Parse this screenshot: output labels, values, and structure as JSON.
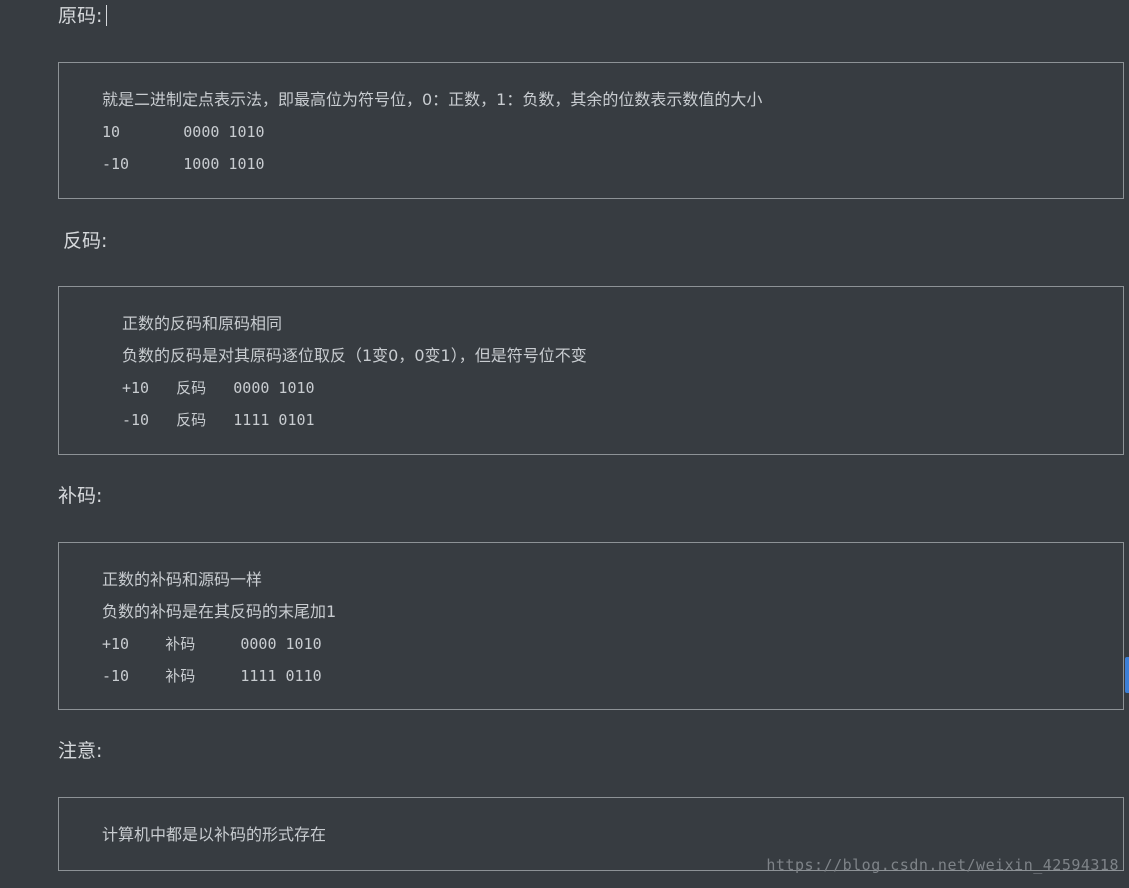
{
  "sections": [
    {
      "heading": "原码:",
      "lines": [
        "就是二进制定点表示法，即最高位为符号位，0：正数，1：负数，其余的位数表示数值的大小",
        "10       0000 1010",
        "-10      1000 1010"
      ]
    },
    {
      "heading": "反码:",
      "lines": [
        "正数的反码和原码相同",
        "负数的反码是对其原码逐位取反（1变0，0变1），但是符号位不变",
        "+10   反码   0000 1010",
        "-10   反码   1111 0101"
      ]
    },
    {
      "heading": "补码:",
      "lines": [
        "正数的补码和源码一样",
        "负数的补码是在其反码的末尾加1",
        "+10    补码     0000 1010",
        "-10    补码     1111 0110"
      ]
    },
    {
      "heading": "注意:",
      "lines": [
        "计算机中都是以补码的形式存在"
      ]
    }
  ],
  "watermark": "https://blog.csdn.net/weixin_42594318",
  "colors": {
    "background": "#373c41",
    "text": "#c8ccd0",
    "box_border": "#8d9296",
    "scroll_marker": "#3d7fd6"
  }
}
